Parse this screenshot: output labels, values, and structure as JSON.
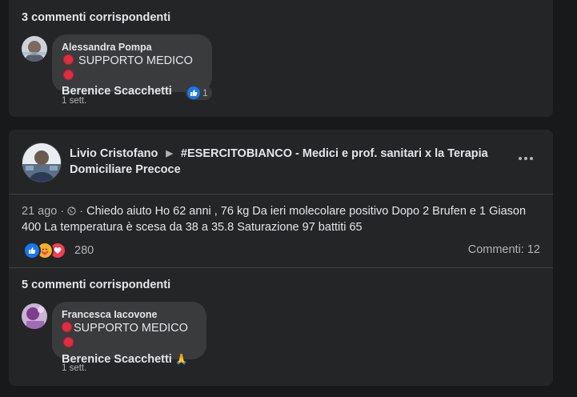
{
  "card1": {
    "matching_comments": "3 commenti corrispondenti",
    "comment": {
      "author": "Alessandra Pompa",
      "line1": "SUPPORTO MEDICO",
      "line2": "Berenice Scacchetti",
      "time": "1 sett.",
      "like_count": "1"
    }
  },
  "post": {
    "author": "Livio Cristofano",
    "group": "#ESERCITOBIANCO - Medici e prof. sanitari x la Terapia Domiciliare Precoce",
    "date": "21 ago",
    "text": "Chiedo aiuto Ho 62 anni , 76 kg Da ieri molecolare positivo Dopo 2 Brufen e 1 Giason 400 La temperatura è scesa da 38 a 35.8 Saturazione 97 battiti 65",
    "reactions_count": "280",
    "comments_label": "Commenti: 12",
    "matching_comments": "5 commenti corrispondenti",
    "comment": {
      "author": "Francesca Iacovone",
      "line1": "SUPPORTO MEDICO",
      "line2": "Berenice Scacchetti",
      "emoji": "🙏",
      "time": "1 sett."
    }
  },
  "colors": {
    "background": "#18191a",
    "card": "#242526",
    "bubble": "#3a3b3c",
    "text": "#e4e6eb",
    "secondary_text": "#b0b3b8",
    "like_blue": "#1877f2",
    "love_red": "#f33e58",
    "red_circle": "#dd2e44"
  },
  "icons": [
    "avatar",
    "like-icon",
    "haha-care-icon",
    "love-icon",
    "globe-icon",
    "more-options-icon",
    "group-arrow-icon",
    "red-circle-emoji",
    "folded-hands-emoji"
  ]
}
